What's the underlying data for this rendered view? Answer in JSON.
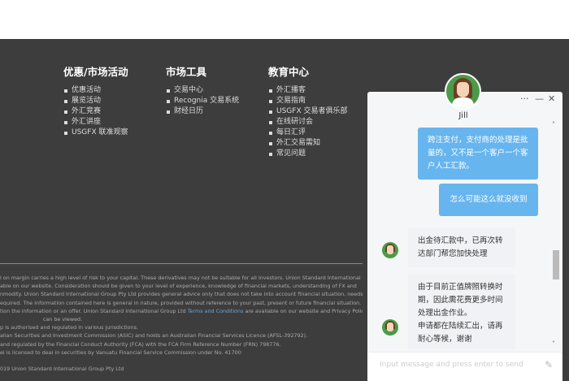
{
  "footer": {
    "columns": [
      {
        "title": "优惠/市场活动",
        "items": [
          "优惠活动",
          "展览活动",
          "外汇竞赛",
          "外汇讲座",
          "USGFX 联准观察"
        ]
      },
      {
        "title": "市场工具",
        "items": [
          "交易中心",
          "Recognia 交易系统",
          "财经日历"
        ]
      },
      {
        "title": "教育中心",
        "items": [
          "外汇播客",
          "交易指南",
          "USGFX 交易者俱乐部",
          "在线研讨会",
          "每日汇评",
          "外汇交易需知",
          "常见问题"
        ]
      }
    ],
    "disclaimer": [
      "l on margin carries a high level of risk to your capital. These derivatives may not be suitable for all investors. Union Standard International",
      "able on our website. Consideration should be given to your level of experience, knowledge of financial markets, understanding of FX and",
      "nmodity. Union Standard International Group Pty Ltd provides general advice only that does not take into account financial situation, needs",
      "equired. The information contained here is general in nature, provided without reference to your past, present or future financial situation.",
      "tion the information or an offer. Union Standard International Group Ltd"
    ],
    "terms_link": "Terms and Conditions",
    "disclaimer_tail": " are available on our website and Privacy Policy",
    "disclaimer_more": [
      "                          can be viewed.",
      "p is authorised and regulated in various jurisdictions.",
      "alian Securities and Investment Commission (ASIC) and holds an Australian Financial Services Licence (AFSL-392792).",
      "and regulated by the Financial Conduct Authority (FCA) with the FCA Firm Reference Number (FRN) 798776.",
      "el is licensed to deal in securities by Vanuatu Financial Service Commission under No. 41700",
      "",
      "019 Union Standard International Group Pty Ltd"
    ]
  },
  "chat": {
    "agent_name": "Jill",
    "controls": {
      "more": "···",
      "minimize": "—",
      "close": "✕"
    },
    "messages": [
      {
        "from": "user",
        "text": "跨注支付，支付商的处理是批量的，又不是一个客户一个客户人工汇款。"
      },
      {
        "from": "user",
        "text": "怎么可能这么就没收到"
      },
      {
        "from": "agent",
        "text": "出金待汇款中，已再次转达部门帮您加快处理"
      },
      {
        "from": "agent",
        "text": "由于目前正值牌照转换时期，因此需花费更多时间处理出金作业。\n申请都在陆续汇出，请再耐心等候，谢谢"
      }
    ],
    "input_placeholder": "Input message and press enter to send",
    "icons": {
      "attach": "paperclip-icon",
      "scroll_up": "chevron-up-icon",
      "scroll_down": "chevron-down-icon"
    }
  }
}
